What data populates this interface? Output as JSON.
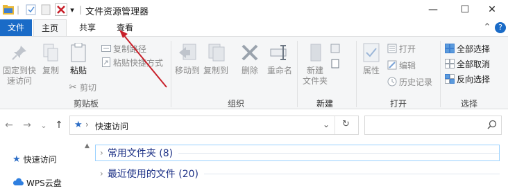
{
  "window": {
    "title": "文件资源管理器",
    "qa_separator": "|",
    "qa_dropdown": "▾",
    "minimize": "—",
    "maximize": "☐",
    "close": "✕"
  },
  "tabs": {
    "file": "文件",
    "home": "主页",
    "share": "共享",
    "view": "查看",
    "collapse": "⌃",
    "help": "?"
  },
  "clipboard": {
    "pin_line1": "固定到快",
    "pin_line2": "速访问",
    "copy": "复制",
    "paste": "粘贴",
    "copy_path": "复制路径",
    "paste_shortcut": "粘贴快捷方式",
    "cut": "剪切",
    "label": "剪贴板"
  },
  "organize": {
    "move_to": "移动到",
    "copy_to": "复制到",
    "delete": "删除",
    "rename": "重命名",
    "label": "组织"
  },
  "new": {
    "new_folder_line1": "新建",
    "new_folder_line2": "文件夹",
    "label": "新建"
  },
  "open": {
    "properties": "属性",
    "open": "打开",
    "edit": "编辑",
    "history": "历史记录",
    "label": "打开"
  },
  "select": {
    "select_all": "全部选择",
    "select_none": "全部取消",
    "invert": "反向选择",
    "label": "选择"
  },
  "address": {
    "back": "←",
    "forward": "→",
    "recent": "⌄",
    "up": "↑",
    "crumb_sep": "›",
    "path": "快速访问",
    "dropdown": "⌄",
    "refresh": "↻",
    "search_placeholder": ""
  },
  "navpane": {
    "quick_access": "快速访问",
    "wps_cloud": "WPS云盘"
  },
  "content": {
    "frequent_folders": "常用文件夹 (8)",
    "recent_files": "最近使用的文件 (20)"
  },
  "colors": {
    "accent": "#1a6bc7",
    "annotation_arrow": "#c8202a"
  }
}
